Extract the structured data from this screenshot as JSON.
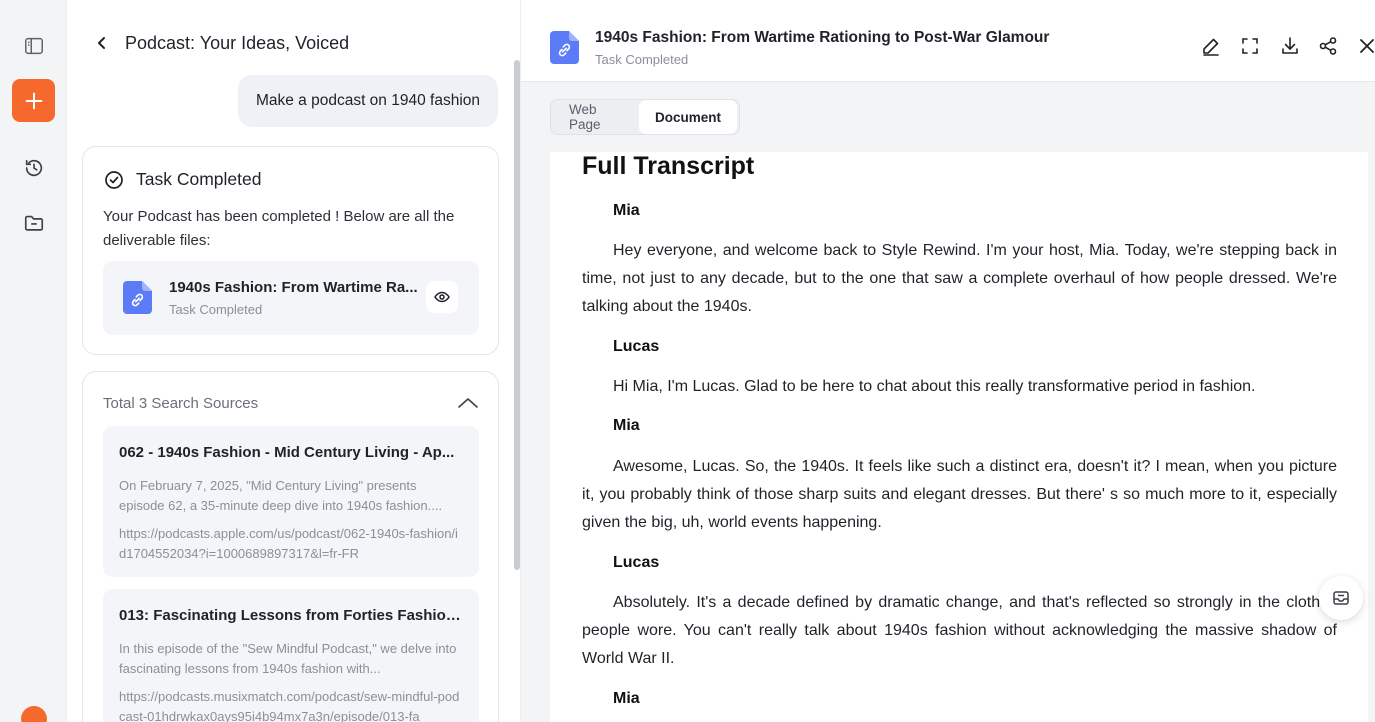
{
  "rail": {
    "icons": [
      "sidebar-toggle-icon",
      "plus-icon",
      "history-icon",
      "folder-icon",
      "app-logo-icon"
    ],
    "accent": "#f56a2c"
  },
  "chat": {
    "title": "Podcast: Your Ideas, Voiced",
    "user_message": "Make a podcast on 1940 fashion",
    "task": {
      "heading": "Task Completed",
      "description": "Your Podcast has been completed ! Below are all the deliverable files:",
      "file": {
        "name": "1940s Fashion: From Wartime Ra...",
        "status": "Task Completed"
      }
    },
    "sources": {
      "heading": "Total 3 Search Sources",
      "items": [
        {
          "title": "062 - 1940s Fashion - Mid Century Living - Ap...",
          "snippet": "On February 7, 2025, \"Mid Century Living\" presents episode 62, a 35-minute deep dive into 1940s fashion....",
          "url": "https://podcasts.apple.com/us/podcast/062-1940s-fashion/id1704552034?i=1000689897317&l=fr-FR"
        },
        {
          "title": "013: Fascinating Lessons from Forties Fashion ...",
          "snippet": "In this episode of the \"Sew Mindful Podcast,\" we delve into fascinating lessons from 1940s fashion with...",
          "url": "https://podcasts.musixmatch.com/podcast/sew-mindful-podcast-01hdrwkax0ays95i4b94mx7a3n/episode/013-fa"
        }
      ]
    }
  },
  "viewer": {
    "title": "1940s Fashion: From Wartime Rationing to Post-War Glamour",
    "status": "Task Completed",
    "tabs": [
      "Web Page",
      "Document"
    ],
    "active_tab": "Document",
    "transcript": {
      "heading": "Full Transcript",
      "entries": [
        {
          "speaker": "Mia",
          "text": "Hey everyone, and welcome back to Style Rewind. I'm your host, Mia. Today, we're stepping back in time, not just to any decade, but to the one that saw a complete overhaul of how people dressed. We're talking about the 1940s."
        },
        {
          "speaker": "Lucas",
          "text": "Hi Mia, I'm Lucas. Glad to be here to chat about this really transformative period in fashion."
        },
        {
          "speaker": "Mia",
          "text": "Awesome, Lucas. So, the 1940s. It feels like such a distinct era, doesn't it? I mean, when you picture it, you probably think of those sharp suits and elegant dresses. But there' s so much more to it, especially given the big, uh, world events happening."
        },
        {
          "speaker": "Lucas",
          "text": "Absolutely. It's a decade defined by dramatic change, and that's reflected so strongly in the clothes people wore. You can't really talk about 1940s fashion without acknowledging the massive shadow of World War II."
        },
        {
          "speaker": "Mia",
          "text": ""
        }
      ]
    }
  }
}
